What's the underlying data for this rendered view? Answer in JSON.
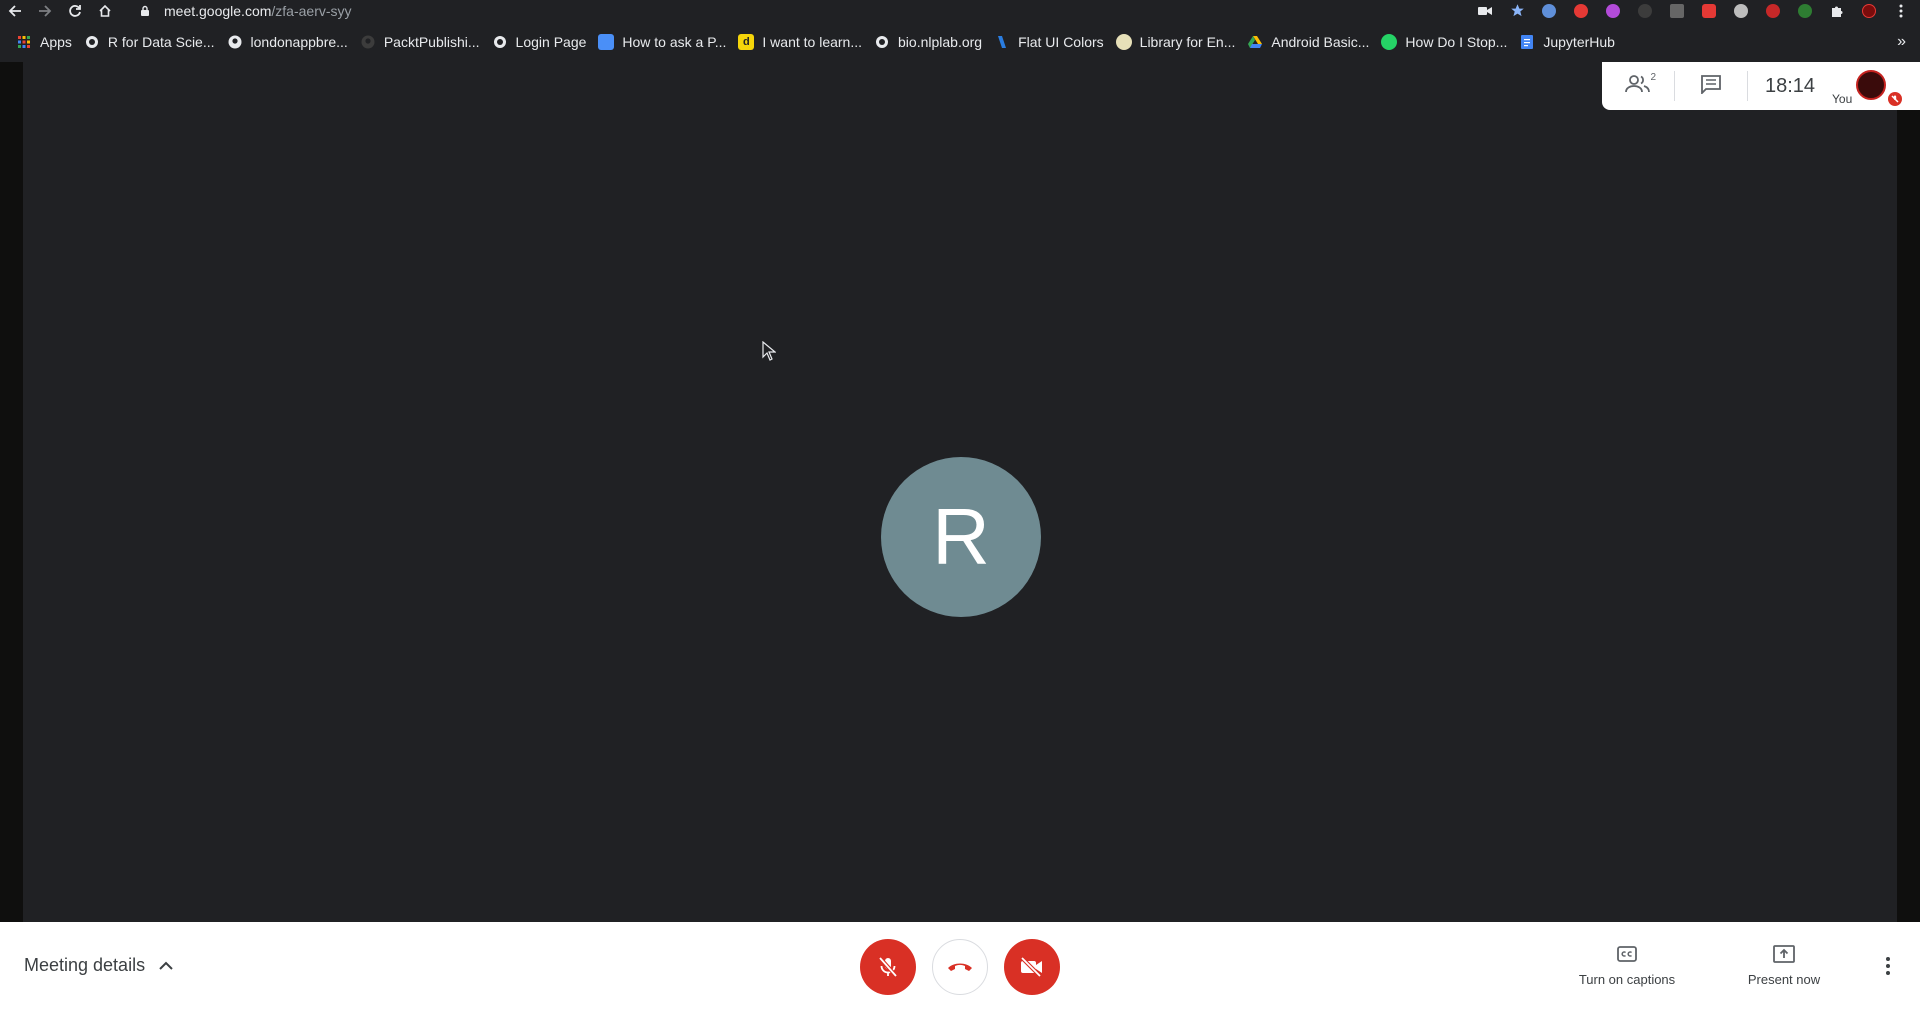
{
  "browser": {
    "url_host": "meet.google.com",
    "url_path": "/zfa-aerv-syy",
    "bookmarks": [
      {
        "label": "Apps",
        "icon": "apps-grid-icon"
      },
      {
        "label": "R for Data Scie...",
        "icon": "globe-icon"
      },
      {
        "label": "londonappbre...",
        "icon": "github-icon"
      },
      {
        "label": "PacktPublishi...",
        "icon": "github-icon"
      },
      {
        "label": "Login Page",
        "icon": "globe-icon"
      },
      {
        "label": "How to ask a P...",
        "icon": "shield-blue-icon"
      },
      {
        "label": "I want to learn...",
        "icon": "d-yellow-icon"
      },
      {
        "label": "bio.nlplab.org",
        "icon": "globe-icon"
      },
      {
        "label": "Flat UI Colors",
        "icon": "flat-ui-icon"
      },
      {
        "label": "Library for En...",
        "icon": "library-icon"
      },
      {
        "label": "Android Basic...",
        "icon": "drive-icon"
      },
      {
        "label": "How Do I Stop...",
        "icon": "whatsapp-icon"
      },
      {
        "label": "JupyterHub",
        "icon": "docs-icon"
      }
    ]
  },
  "meeting": {
    "participant_initial": "R",
    "participant_count": "2",
    "time": "18:14",
    "self_label": "You",
    "details_label": "Meeting details",
    "captions_label": "Turn on captions",
    "present_label": "Present now"
  },
  "colors": {
    "stage_bg": "#202124",
    "avatar_bg": "#6f8b92",
    "danger_red": "#d93025"
  }
}
